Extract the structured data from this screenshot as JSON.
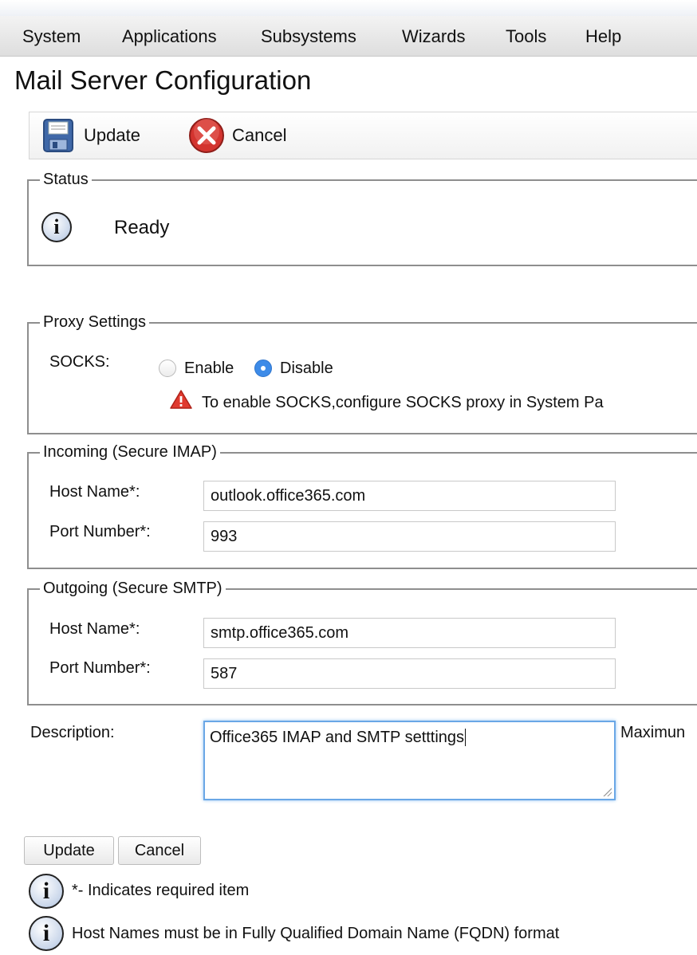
{
  "menu": [
    "System",
    "Applications",
    "Subsystems",
    "Wizards",
    "Tools",
    "Help"
  ],
  "page_title": "Mail Server Configuration",
  "toolbar": {
    "update_label": "Update",
    "cancel_label": "Cancel"
  },
  "status": {
    "legend": "Status",
    "text": "Ready"
  },
  "proxy": {
    "legend": "Proxy Settings",
    "socks_label": "SOCKS:",
    "enable_label": "Enable",
    "disable_label": "Disable",
    "selected": "Disable",
    "warning": "To enable SOCKS,configure SOCKS proxy in System Pa"
  },
  "incoming": {
    "legend": "Incoming (Secure IMAP)",
    "host_label": "Host Name*:",
    "host_value": "outlook.office365.com",
    "port_label": "Port Number*:",
    "port_value": "993"
  },
  "outgoing": {
    "legend": "Outgoing (Secure SMTP)",
    "host_label": "Host Name*:",
    "host_value": "smtp.office365.com",
    "port_label": "Port Number*:",
    "port_value": "587"
  },
  "description": {
    "label": "Description:",
    "value": "Office365 IMAP and SMTP setttings",
    "maximum_label": "Maximun"
  },
  "buttons": {
    "update": "Update",
    "cancel": "Cancel"
  },
  "notes": [
    "*- Indicates required item",
    "Host Names must be in Fully Qualified Domain Name (FQDN) format"
  ],
  "colors": {
    "radio_selected": "#3d8be8",
    "cancel_icon": "#d3342f",
    "warning_icon": "#e03a2f",
    "textarea_focus": "#6aa7e6"
  }
}
